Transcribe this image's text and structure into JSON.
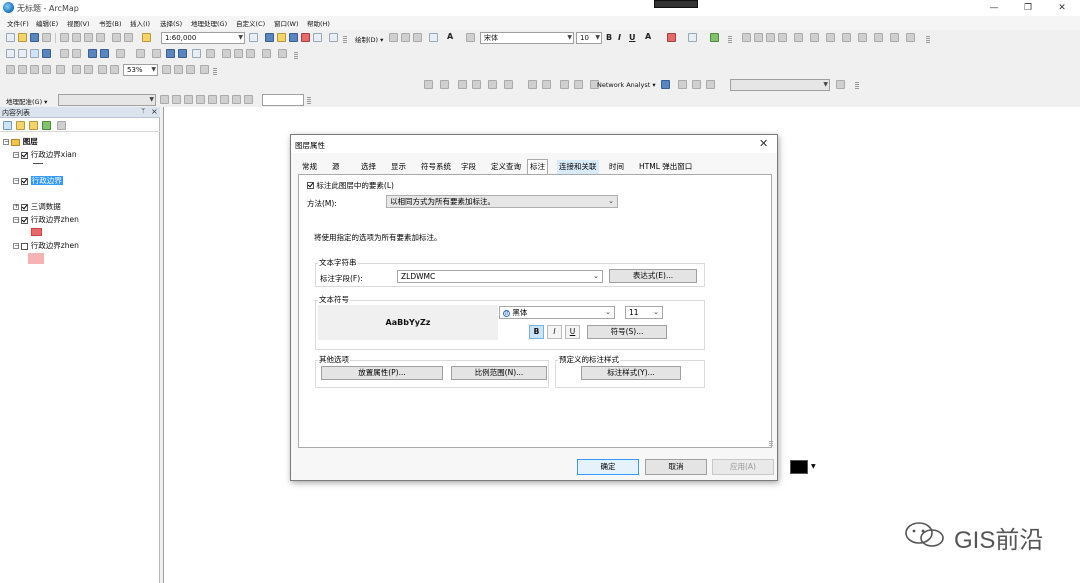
{
  "window": {
    "title": "无标题 - ArcMap",
    "controls": {
      "minimize": "—",
      "maximize": "❐",
      "close": "✕"
    }
  },
  "menu": [
    "文件(F)",
    "编辑(E)",
    "视图(V)",
    "书签(B)",
    "插入(I)",
    "选择(S)",
    "地理处理(G)",
    "自定义(C)",
    "窗口(W)",
    "帮助(H)"
  ],
  "toolbar": {
    "scale": "1:60,000",
    "drawing_label": "绘制(D) ▾",
    "font": "宋体",
    "font_size": "10",
    "bold": "B",
    "italic": "I",
    "underline": "U",
    "text_tool": "A",
    "zoom": "53%",
    "network_analyst": "Network Analyst ▾",
    "georef_label": "地理配准(G) ▾"
  },
  "toc": {
    "title": "内容列表",
    "pin": "ᛘ",
    "close": "×",
    "root": "图层",
    "layers": [
      {
        "name": "行政边界xian",
        "checked": true,
        "selected": false
      },
      {
        "name": "行政边界",
        "checked": true,
        "selected": true
      },
      {
        "name": "三调数据",
        "checked": true,
        "selected": false
      },
      {
        "name": "行政边界zhen",
        "checked": true,
        "selected": false
      },
      {
        "name": "行政边界zhen",
        "checked": false,
        "selected": false
      }
    ]
  },
  "dialog": {
    "title": "图层属性",
    "close": "✕",
    "tabs": [
      "常规",
      "源",
      "选择",
      "显示",
      "符号系统",
      "字段",
      "定义查询",
      "标注",
      "连接和关联",
      "时间",
      "HTML 弹出窗口"
    ],
    "active_tab": "标注",
    "label_checkbox": "标注此图层中的要素(L)",
    "method_label": "方法(M):",
    "method_value": "以相同方式为所有要素加标注。",
    "description": "将使用指定的选项为所有要素加标注。",
    "text_string": {
      "group_title": "文本字符串",
      "field_label": "标注字段(F):",
      "field_value": "ZLDWMC",
      "expression_button": "表达式(E)..."
    },
    "text_symbol": {
      "group_title": "文本符号",
      "preview": "AaBbYyZz",
      "font": "黑体",
      "size": "11",
      "color": "#000000",
      "bold": "B",
      "italic": "I",
      "underline": "U",
      "symbol_button": "符号(S)..."
    },
    "other_options": {
      "group_title": "其他选项",
      "placement_button": "放置属性(P)...",
      "scale_button": "比例范围(N)..."
    },
    "predefined": {
      "group_title": "预定义的标注样式",
      "style_button": "标注样式(Y)..."
    },
    "buttons": {
      "ok": "确定",
      "cancel": "取消",
      "apply": "应用(A)"
    }
  },
  "watermark": {
    "text": "GIS前沿"
  }
}
